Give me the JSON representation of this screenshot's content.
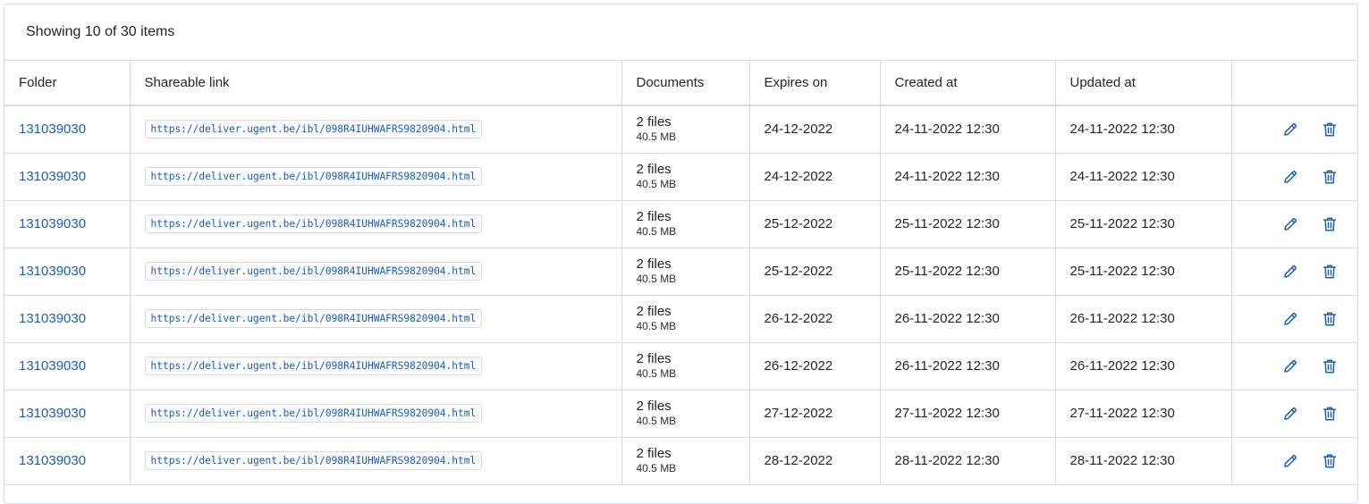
{
  "summary": "Showing 10 of 30 items",
  "columns": {
    "folder": "Folder",
    "link": "Shareable link",
    "documents": "Documents",
    "expires": "Expires on",
    "created": "Created at",
    "updated": "Updated at",
    "actions": ""
  },
  "rows": [
    {
      "folder": "131039030",
      "link": "https://deliver.ugent.be/ibl/098R4IUHWAFRS9820904.html",
      "files": "2 files",
      "size": "40.5 MB",
      "expires": "24-12-2022",
      "created": "24-11-2022 12:30",
      "updated": "24-11-2022 12:30"
    },
    {
      "folder": "131039030",
      "link": "https://deliver.ugent.be/ibl/098R4IUHWAFRS9820904.html",
      "files": "2 files",
      "size": "40.5 MB",
      "expires": "24-12-2022",
      "created": "24-11-2022 12:30",
      "updated": "24-11-2022 12:30"
    },
    {
      "folder": "131039030",
      "link": "https://deliver.ugent.be/ibl/098R4IUHWAFRS9820904.html",
      "files": "2 files",
      "size": "40.5 MB",
      "expires": "25-12-2022",
      "created": "25-11-2022 12:30",
      "updated": "25-11-2022 12:30"
    },
    {
      "folder": "131039030",
      "link": "https://deliver.ugent.be/ibl/098R4IUHWAFRS9820904.html",
      "files": "2 files",
      "size": "40.5 MB",
      "expires": "25-12-2022",
      "created": "25-11-2022 12:30",
      "updated": "25-11-2022 12:30"
    },
    {
      "folder": "131039030",
      "link": "https://deliver.ugent.be/ibl/098R4IUHWAFRS9820904.html",
      "files": "2 files",
      "size": "40.5 MB",
      "expires": "26-12-2022",
      "created": "26-11-2022 12:30",
      "updated": "26-11-2022 12:30"
    },
    {
      "folder": "131039030",
      "link": "https://deliver.ugent.be/ibl/098R4IUHWAFRS9820904.html",
      "files": "2 files",
      "size": "40.5 MB",
      "expires": "26-12-2022",
      "created": "26-11-2022 12:30",
      "updated": "26-11-2022 12:30"
    },
    {
      "folder": "131039030",
      "link": "https://deliver.ugent.be/ibl/098R4IUHWAFRS9820904.html",
      "files": "2 files",
      "size": "40.5 MB",
      "expires": "27-12-2022",
      "created": "27-11-2022 12:30",
      "updated": "27-11-2022 12:30"
    },
    {
      "folder": "131039030",
      "link": "https://deliver.ugent.be/ibl/098R4IUHWAFRS9820904.html",
      "files": "2 files",
      "size": "40.5 MB",
      "expires": "28-12-2022",
      "created": "28-11-2022 12:30",
      "updated": "28-11-2022 12:30"
    }
  ],
  "icons": {
    "edit": "pencil-icon",
    "delete": "trash-icon"
  },
  "colors": {
    "link": "#1a5fb4",
    "border": "#d8dbe0",
    "text": "#1f2329"
  }
}
